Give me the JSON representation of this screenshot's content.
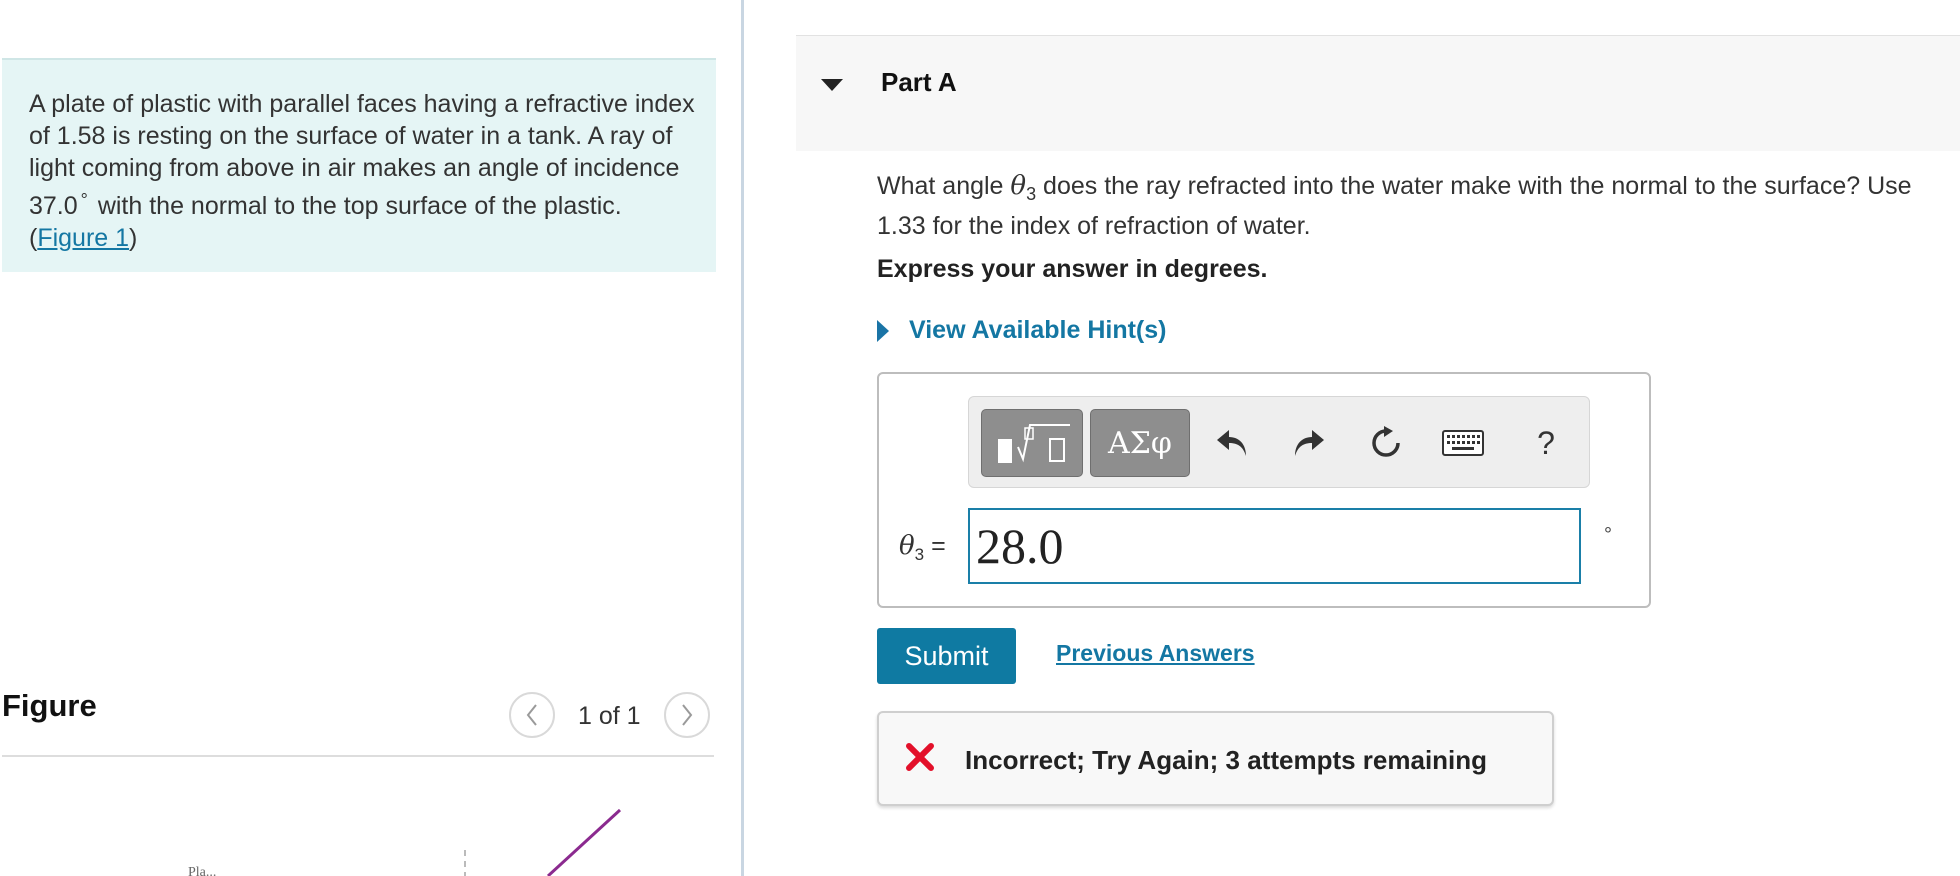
{
  "problem": {
    "text_part1": "A plate of plastic with parallel faces having a refractive index of 1.58 is resting on the surface of water in a tank. A ray of light coming from above in air makes an angle of incidence 37.0",
    "degree_symbol": "°",
    "text_part2": " with the normal to the top surface of the plastic. (",
    "figure_link": "Figure 1",
    "text_end": ")"
  },
  "figure": {
    "title": "Figure",
    "prev_icon": "chevron-left-icon",
    "next_icon": "chevron-right-icon",
    "counter": "1 of 1",
    "partial_label": "Pla..."
  },
  "part": {
    "title": "Part A",
    "caret_icon": "caret-down-icon"
  },
  "question": {
    "text_before": "What angle ",
    "symbol": "θ",
    "subscript": "3",
    "text_after": " does the ray refracted into the water make with the normal to the surface? Use 1.33 for the index of refraction of water."
  },
  "instruction": "Express your answer in degrees.",
  "hints_label": "View Available Hint(s)",
  "toolbar": {
    "templates_icon": "math-templates-icon",
    "greek_label": "ΑΣφ",
    "undo_icon": "undo-icon",
    "redo_icon": "redo-icon",
    "reset_icon": "reset-icon",
    "keyboard_icon": "keyboard-icon",
    "help_label": "?"
  },
  "answer": {
    "var_symbol": "θ",
    "var_subscript": "3",
    "equals": " =",
    "value": "28.0",
    "unit": "°"
  },
  "submit_label": "Submit",
  "previous_answers_label": "Previous Answers",
  "feedback": {
    "icon": "x-icon",
    "message": "Incorrect; Try Again; 3 attempts remaining"
  },
  "colors": {
    "accent": "#1477a3",
    "submit_bg": "#0f7aa2",
    "problem_bg": "#e5f5f5",
    "error_red": "#e3102a"
  }
}
